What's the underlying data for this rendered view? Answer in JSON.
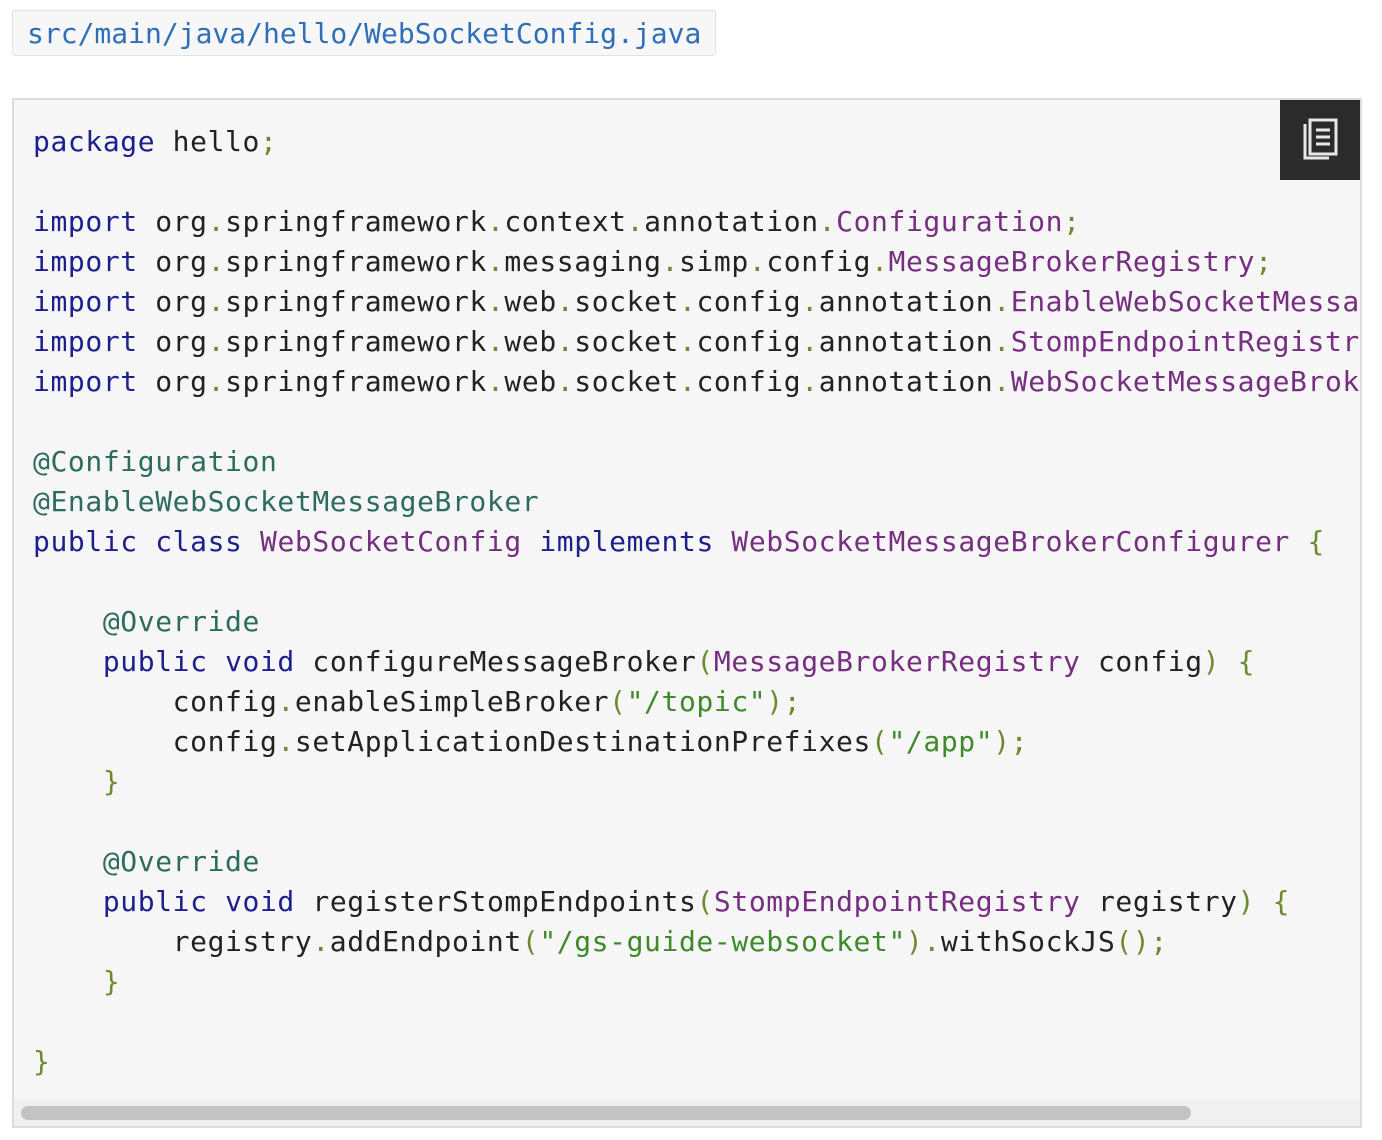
{
  "file_path": "src/main/java/hello/WebSocketConfig.java",
  "copy_icon": "copy-clipboard-icon",
  "code_lines": [
    [
      [
        "kw",
        "package"
      ],
      [
        "id",
        " hello"
      ],
      [
        "punct",
        ";"
      ]
    ],
    [],
    [
      [
        "kw",
        "import"
      ],
      [
        "id",
        " org"
      ],
      [
        "punct",
        "."
      ],
      [
        "id",
        "springframework"
      ],
      [
        "punct",
        "."
      ],
      [
        "id",
        "context"
      ],
      [
        "punct",
        "."
      ],
      [
        "id",
        "annotation"
      ],
      [
        "punct",
        "."
      ],
      [
        "type",
        "Configuration"
      ],
      [
        "punct",
        ";"
      ]
    ],
    [
      [
        "kw",
        "import"
      ],
      [
        "id",
        " org"
      ],
      [
        "punct",
        "."
      ],
      [
        "id",
        "springframework"
      ],
      [
        "punct",
        "."
      ],
      [
        "id",
        "messaging"
      ],
      [
        "punct",
        "."
      ],
      [
        "id",
        "simp"
      ],
      [
        "punct",
        "."
      ],
      [
        "id",
        "config"
      ],
      [
        "punct",
        "."
      ],
      [
        "type",
        "MessageBrokerRegistry"
      ],
      [
        "punct",
        ";"
      ]
    ],
    [
      [
        "kw",
        "import"
      ],
      [
        "id",
        " org"
      ],
      [
        "punct",
        "."
      ],
      [
        "id",
        "springframework"
      ],
      [
        "punct",
        "."
      ],
      [
        "id",
        "web"
      ],
      [
        "punct",
        "."
      ],
      [
        "id",
        "socket"
      ],
      [
        "punct",
        "."
      ],
      [
        "id",
        "config"
      ],
      [
        "punct",
        "."
      ],
      [
        "id",
        "annotation"
      ],
      [
        "punct",
        "."
      ],
      [
        "type",
        "EnableWebSocketMessageBroker"
      ],
      [
        "punct",
        ";"
      ]
    ],
    [
      [
        "kw",
        "import"
      ],
      [
        "id",
        " org"
      ],
      [
        "punct",
        "."
      ],
      [
        "id",
        "springframework"
      ],
      [
        "punct",
        "."
      ],
      [
        "id",
        "web"
      ],
      [
        "punct",
        "."
      ],
      [
        "id",
        "socket"
      ],
      [
        "punct",
        "."
      ],
      [
        "id",
        "config"
      ],
      [
        "punct",
        "."
      ],
      [
        "id",
        "annotation"
      ],
      [
        "punct",
        "."
      ],
      [
        "type",
        "StompEndpointRegistry"
      ],
      [
        "punct",
        ";"
      ]
    ],
    [
      [
        "kw",
        "import"
      ],
      [
        "id",
        " org"
      ],
      [
        "punct",
        "."
      ],
      [
        "id",
        "springframework"
      ],
      [
        "punct",
        "."
      ],
      [
        "id",
        "web"
      ],
      [
        "punct",
        "."
      ],
      [
        "id",
        "socket"
      ],
      [
        "punct",
        "."
      ],
      [
        "id",
        "config"
      ],
      [
        "punct",
        "."
      ],
      [
        "id",
        "annotation"
      ],
      [
        "punct",
        "."
      ],
      [
        "type",
        "WebSocketMessageBrokerConfigurer"
      ],
      [
        "punct",
        ";"
      ]
    ],
    [],
    [
      [
        "ann",
        "@Configuration"
      ]
    ],
    [
      [
        "ann",
        "@EnableWebSocketMessageBroker"
      ]
    ],
    [
      [
        "kw",
        "public"
      ],
      [
        "id",
        " "
      ],
      [
        "kw",
        "class"
      ],
      [
        "id",
        " "
      ],
      [
        "type",
        "WebSocketConfig"
      ],
      [
        "id",
        " "
      ],
      [
        "kw",
        "implements"
      ],
      [
        "id",
        " "
      ],
      [
        "type",
        "WebSocketMessageBrokerConfigurer"
      ],
      [
        "id",
        " "
      ],
      [
        "punct",
        "{"
      ]
    ],
    [],
    [
      [
        "id",
        "    "
      ],
      [
        "ann",
        "@Override"
      ]
    ],
    [
      [
        "id",
        "    "
      ],
      [
        "kw",
        "public"
      ],
      [
        "id",
        " "
      ],
      [
        "kw",
        "void"
      ],
      [
        "id",
        " configureMessageBroker"
      ],
      [
        "punct",
        "("
      ],
      [
        "type",
        "MessageBrokerRegistry"
      ],
      [
        "id",
        " config"
      ],
      [
        "punct",
        ")"
      ],
      [
        "id",
        " "
      ],
      [
        "punct",
        "{"
      ]
    ],
    [
      [
        "id",
        "        config"
      ],
      [
        "punct",
        "."
      ],
      [
        "id",
        "enableSimpleBroker"
      ],
      [
        "punct",
        "("
      ],
      [
        "str",
        "\"/topic\""
      ],
      [
        "punct",
        ");"
      ]
    ],
    [
      [
        "id",
        "        config"
      ],
      [
        "punct",
        "."
      ],
      [
        "id",
        "setApplicationDestinationPrefixes"
      ],
      [
        "punct",
        "("
      ],
      [
        "str",
        "\"/app\""
      ],
      [
        "punct",
        ");"
      ]
    ],
    [
      [
        "id",
        "    "
      ],
      [
        "punct",
        "}"
      ]
    ],
    [],
    [
      [
        "id",
        "    "
      ],
      [
        "ann",
        "@Override"
      ]
    ],
    [
      [
        "id",
        "    "
      ],
      [
        "kw",
        "public"
      ],
      [
        "id",
        " "
      ],
      [
        "kw",
        "void"
      ],
      [
        "id",
        " registerStompEndpoints"
      ],
      [
        "punct",
        "("
      ],
      [
        "type",
        "StompEndpointRegistry"
      ],
      [
        "id",
        " registry"
      ],
      [
        "punct",
        ")"
      ],
      [
        "id",
        " "
      ],
      [
        "punct",
        "{"
      ]
    ],
    [
      [
        "id",
        "        registry"
      ],
      [
        "punct",
        "."
      ],
      [
        "id",
        "addEndpoint"
      ],
      [
        "punct",
        "("
      ],
      [
        "str",
        "\"/gs-guide-websocket\""
      ],
      [
        "punct",
        ")."
      ],
      [
        "id",
        "withSockJS"
      ],
      [
        "punct",
        "();"
      ]
    ],
    [
      [
        "id",
        "    "
      ],
      [
        "punct",
        "}"
      ]
    ],
    [],
    [
      [
        "punct",
        "}"
      ]
    ]
  ],
  "colors": {
    "keyword": "#1d1f8c",
    "type": "#762e80",
    "annotation": "#2d6b5e",
    "string": "#3e8a2a",
    "punctuation": "#6d8a2e",
    "identifier": "#222222",
    "path_link": "#2f6fb8",
    "copy_button_bg": "#2b2b2b"
  },
  "horizontal_scroll_fraction": 0.87
}
